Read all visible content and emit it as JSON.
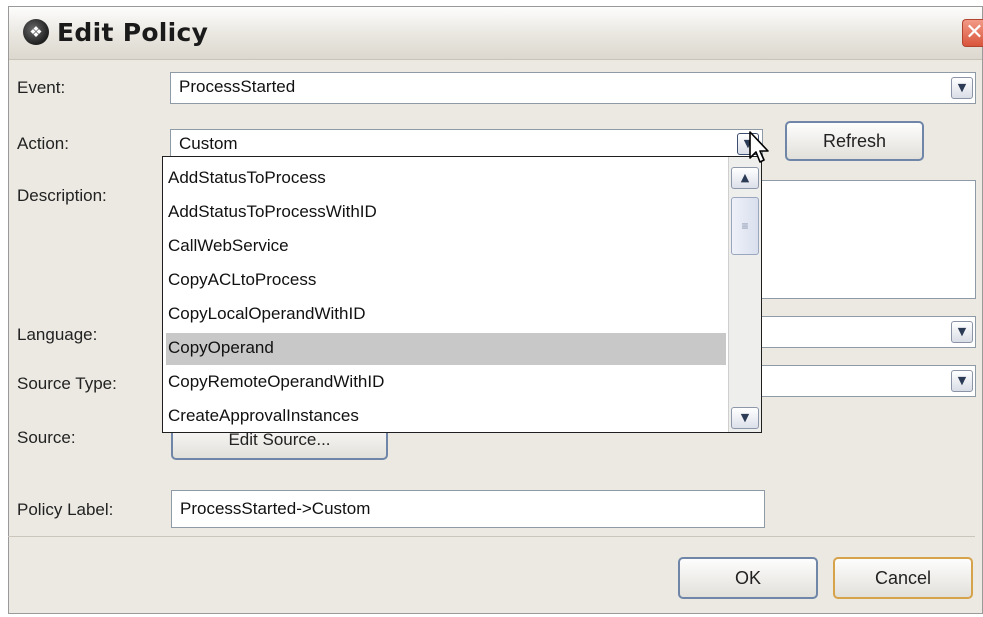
{
  "window": {
    "title": "Edit Policy",
    "title_icon": "app-logo-icon",
    "close_icon": "close-icon"
  },
  "form": {
    "event_label": "Event:",
    "event_value": "ProcessStarted",
    "action_label": "Action:",
    "action_value": "Custom",
    "refresh_label": "Refresh",
    "description_label": "Description:",
    "language_label": "Language:",
    "source_type_label": "Source Type:",
    "source_label": "Source:",
    "edit_source_label": "Edit Source...",
    "policy_label_label": "Policy Label:",
    "policy_label_value": "ProcessStarted->Custom"
  },
  "action_dropdown": {
    "selected_item": "CopyOperand",
    "items": [
      "AddStatusToProcess",
      "AddStatusToProcessWithID",
      "CallWebService",
      "CopyACLtoProcess",
      "CopyLocalOperandWithID",
      "CopyOperand",
      "CopyRemoteOperandWithID",
      "CreateApprovalInstances"
    ]
  },
  "footer": {
    "ok_label": "OK",
    "cancel_label": "Cancel"
  },
  "colors": {
    "window_bg": "#ece9e2",
    "button_border": "#6f86a8",
    "cancel_border": "#d6a24a",
    "selection_bg": "#c8c8c8",
    "close_button": "#d9553c"
  }
}
